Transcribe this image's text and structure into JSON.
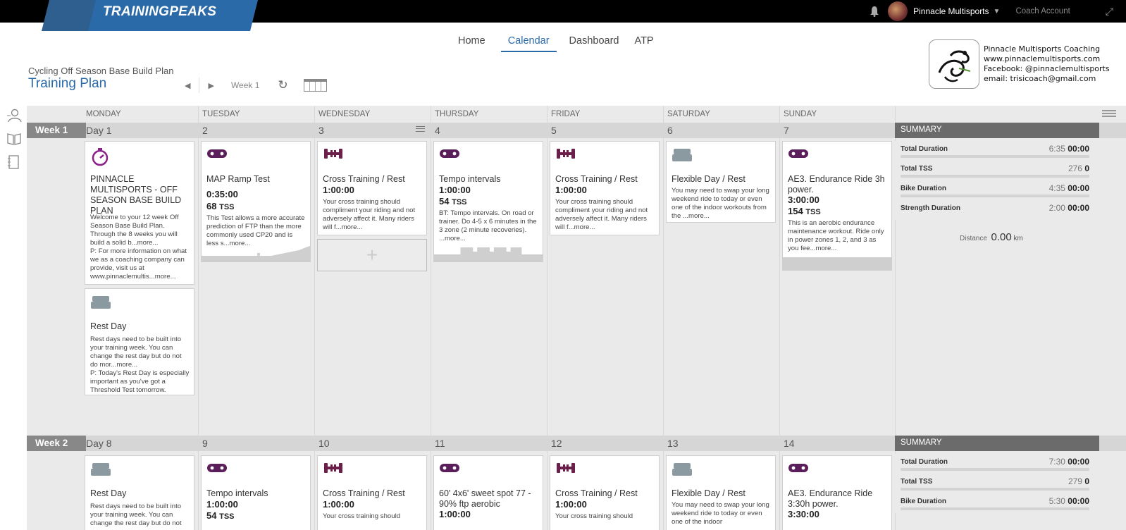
{
  "brand": {
    "logo_text": "TRAININGPEAKS"
  },
  "account": {
    "name": "Pinnacle Multisports",
    "coach_label": "Coach Account"
  },
  "nav": {
    "home": "Home",
    "calendar": "Calendar",
    "dashboard": "Dashboard",
    "atp": "ATP"
  },
  "plan": {
    "subtitle": "Cycling Off Season Base Build Plan",
    "title": "Training Plan",
    "week_label": "Week 1"
  },
  "coaching": {
    "line1": "Pinnacle Multisports Coaching",
    "line2": "www.pinnaclemultisports.com",
    "line3": "Facebook: @pinnaclemultisports",
    "line4": "email: trisicoach@gmail.com"
  },
  "days": [
    "MONDAY",
    "TUESDAY",
    "WEDNESDAY",
    "THURSDAY",
    "FRIDAY",
    "SATURDAY",
    "SUNDAY"
  ],
  "week1": {
    "label": "Week 1",
    "nums": [
      "Day 1",
      "2",
      "3",
      "4",
      "5",
      "6",
      "7"
    ],
    "summary_title": "SUMMARY",
    "summary": {
      "total_duration_lbl": "Total Duration",
      "total_duration_a": "6:35",
      "total_duration_b": "00:00",
      "total_tss_lbl": "Total TSS",
      "total_tss_a": "276",
      "total_tss_b": "0",
      "bike_lbl": "Bike Duration",
      "bike_a": "4:35",
      "bike_b": "00:00",
      "strength_lbl": "Strength Duration",
      "strength_a": "2:00",
      "strength_b": "00:00",
      "distance_lbl": "Distance",
      "distance_val": "0.00",
      "distance_unit": "km"
    },
    "mon_a": {
      "title": "PINNACLE MULTISPORTS - OFF SEASON BASE BUILD PLAN",
      "desc": "Welcome to your 12 week Off Season Base Build Plan. Through the 8 weeks you will build a solid b...more...\nP: For more information on what we as a coaching company can provide, visit us at www.pinnaclemultis...more..."
    },
    "mon_b": {
      "title": "Rest Day",
      "desc": "Rest days need to be built into your training week. You can change the rest day but do not do mor...more...\nP: Today's Rest Day is especially important as you've got a Threshold Test tomorrow."
    },
    "tue": {
      "title": "MAP Ramp Test",
      "dur": "0:35:00",
      "tss": "68",
      "tss_unit": "TSS",
      "desc": "This Test allows a more accurate prediction of FTP than the more commonly used CP20 and is less s...more..."
    },
    "wed": {
      "title": "Cross Training / Rest",
      "dur": "1:00:00",
      "desc": "Your cross training should compliment your riding and not adversely affect it. Many riders will f...more...",
      "plus": "+"
    },
    "thu": {
      "title": "Tempo intervals",
      "dur": "1:00:00",
      "tss": "54",
      "tss_unit": "TSS",
      "desc": "BT: Tempo intervals. On road or trainer. Do 4-5 x 6 minutes in the 3 zone (2 minute recoveries). ...more..."
    },
    "fri": {
      "title": "Cross Training / Rest",
      "dur": "1:00:00",
      "desc": "Your cross training should compliment your riding and not adversely affect it. Many riders will f...more..."
    },
    "sat": {
      "title": "Flexible Day / Rest",
      "desc": "You may need to swap your long weekend ride to today or even one of the indoor workouts from the ...more..."
    },
    "sun": {
      "title": "AE3. Endurance Ride 3h power.",
      "dur": "3:00:00",
      "tss": "154",
      "tss_unit": "TSS",
      "desc": "This is an aerobic endurance maintenance workout. Ride only in power zones 1, 2, and 3 as you fee...more..."
    }
  },
  "week2": {
    "label": "Week 2",
    "nums": [
      "Day 8",
      "9",
      "10",
      "11",
      "12",
      "13",
      "14"
    ],
    "summary_title": "SUMMARY",
    "summary": {
      "total_duration_lbl": "Total Duration",
      "total_duration_a": "7:30",
      "total_duration_b": "00:00",
      "total_tss_lbl": "Total TSS",
      "total_tss_a": "279",
      "total_tss_b": "0",
      "bike_lbl": "Bike Duration",
      "bike_a": "5:30",
      "bike_b": "00:00"
    },
    "mon": {
      "title": "Rest Day",
      "desc": "Rest days need to be built into your training week. You can change the rest day but do not"
    },
    "tue": {
      "title": "Tempo intervals",
      "dur": "1:00:00",
      "tss": "54",
      "tss_unit": "TSS"
    },
    "wed": {
      "title": "Cross Training / Rest",
      "dur": "1:00:00",
      "desc": "Your cross training should"
    },
    "thu": {
      "title": "60' 4x6' sweet spot 77 - 90% ftp aerobic",
      "dur": "1:00:00"
    },
    "fri": {
      "title": "Cross Training / Rest",
      "dur": "1:00:00",
      "desc": "Your cross training should"
    },
    "sat": {
      "title": "Flexible Day / Rest",
      "desc": "You may need to swap your long weekend ride to today or even one of the indoor"
    },
    "sun": {
      "title": "AE3. Endurance Ride 3:30h power.",
      "dur": "3:30:00"
    }
  },
  "colors": {
    "accent": "#2a6aa8",
    "bike": "#5a1f5a",
    "strength": "#6b1f4a",
    "rest": "#8a9aa0",
    "stopwatch": "#8a1f8a"
  }
}
